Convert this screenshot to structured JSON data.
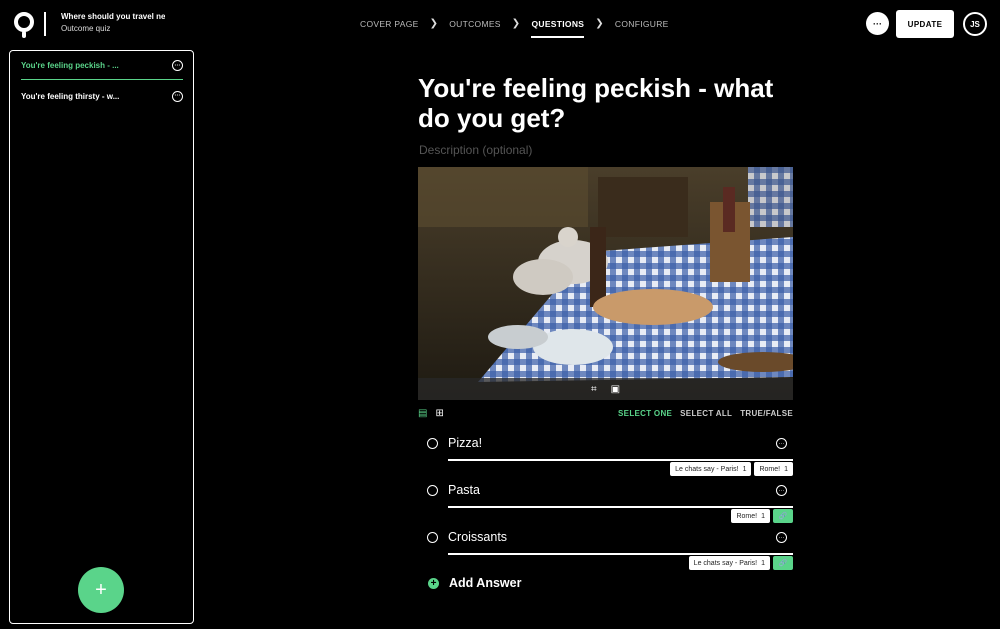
{
  "header": {
    "quiz_title": "Where should you travel next?",
    "quiz_type": "Outcome quiz",
    "steps": [
      {
        "label": "COVER PAGE"
      },
      {
        "label": "OUTCOMES"
      },
      {
        "label": "QUESTIONS"
      },
      {
        "label": "CONFIGURE"
      }
    ],
    "more_icon": "ellipsis-icon",
    "update_label": "UPDATE",
    "avatar_initials": "JS"
  },
  "sidebar": {
    "questions": [
      {
        "label": "You're feeling peckish - ..."
      },
      {
        "label": "You're feeling thirsty - w..."
      }
    ],
    "add_icon": "+"
  },
  "question": {
    "title": "You're feeling peckish - what do you get?",
    "description_placeholder": "Description (optional)",
    "image_tools": [
      "crop-icon",
      "replace-image-icon"
    ]
  },
  "answer_modes": {
    "select_one": "SELECT ONE",
    "select_all": "SELECT ALL",
    "true_false": "TRUE/FALSE"
  },
  "answers": [
    {
      "label": "Pizza!",
      "tags": [
        {
          "name": "Le chats say - Paris!",
          "weight": "1"
        },
        {
          "name": "Rome!",
          "weight": "1"
        }
      ]
    },
    {
      "label": "Pasta",
      "tags": [
        {
          "name": "Rome!",
          "weight": "1"
        }
      ]
    },
    {
      "label": "Croissants",
      "tags": [
        {
          "name": "Le chats say - Paris!",
          "weight": "1"
        }
      ]
    }
  ],
  "add_answer_label": "Add Answer",
  "colors": {
    "accent": "#5ad48a",
    "background": "#000000"
  }
}
